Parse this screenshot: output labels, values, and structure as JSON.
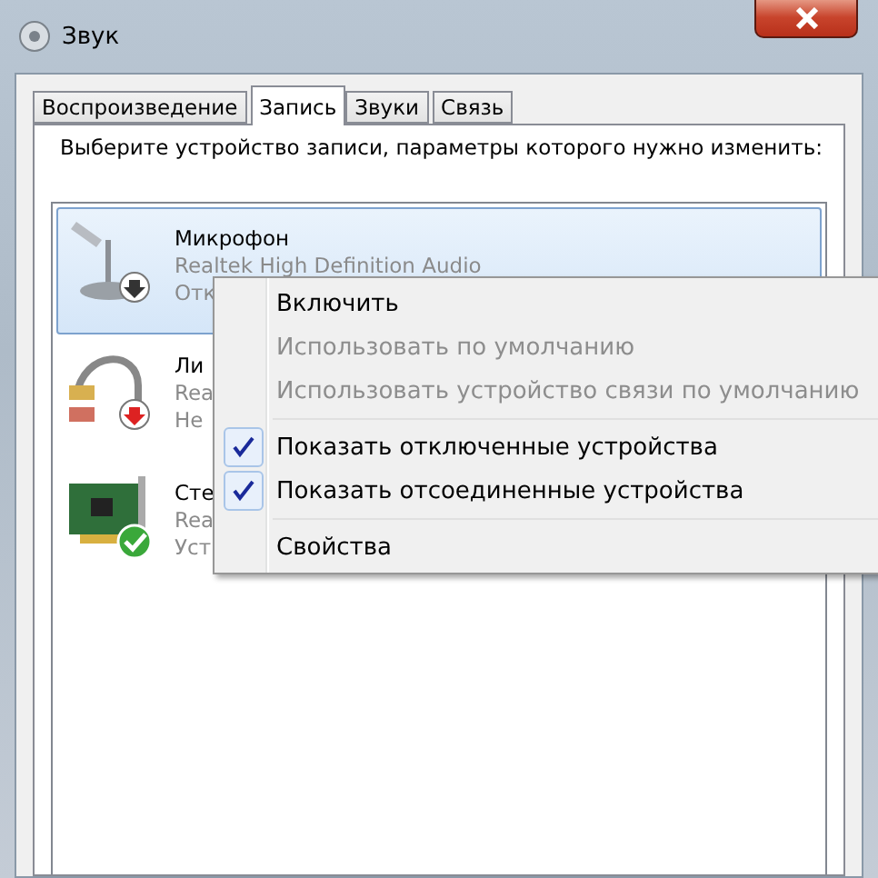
{
  "window": {
    "title": "Звук"
  },
  "tabs": [
    {
      "label": "Воспроизведение",
      "selected": false
    },
    {
      "label": "Запись",
      "selected": true
    },
    {
      "label": "Звуки",
      "selected": false
    },
    {
      "label": "Связь",
      "selected": false
    }
  ],
  "instruction": "Выберите устройство записи, параметры которого нужно изменить:",
  "devices": [
    {
      "name": "Микрофон",
      "driver": "Realtek High Definition Audio",
      "status_text": "Отк",
      "kind": "microphone",
      "disabled": true,
      "unplugged": false,
      "default": false,
      "selected": true
    },
    {
      "name": "Ли",
      "driver": "Rea",
      "status_text": "Не",
      "kind": "line-in",
      "disabled": false,
      "unplugged": true,
      "default": false,
      "selected": false
    },
    {
      "name": "Сте",
      "driver": "Rea",
      "status_text": "Уст",
      "kind": "sound-card",
      "disabled": false,
      "unplugged": false,
      "default": true,
      "selected": false
    }
  ],
  "context_menu": [
    {
      "kind": "item",
      "label": "Включить",
      "disabled": false,
      "checked": false
    },
    {
      "kind": "item",
      "label": "Использовать по умолчанию",
      "disabled": true,
      "checked": false
    },
    {
      "kind": "item",
      "label": "Использовать устройство связи по умолчанию",
      "disabled": true,
      "checked": false
    },
    {
      "kind": "separator"
    },
    {
      "kind": "item",
      "label": "Показать отключенные устройства",
      "disabled": false,
      "checked": true
    },
    {
      "kind": "item",
      "label": "Показать отсоединенные устройства",
      "disabled": false,
      "checked": true
    },
    {
      "kind": "separator"
    },
    {
      "kind": "item",
      "label": "Свойства",
      "disabled": false,
      "checked": false
    }
  ]
}
